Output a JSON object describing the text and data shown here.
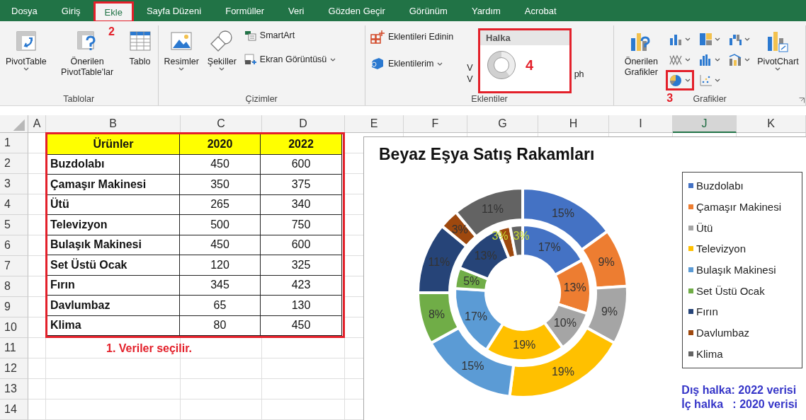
{
  "ribbon_tabs": [
    {
      "label": "Dosya",
      "selected": false
    },
    {
      "label": "Giriş",
      "selected": false
    },
    {
      "label": "Ekle",
      "selected": true,
      "callout": "2"
    },
    {
      "label": "Sayfa Düzeni",
      "selected": false
    },
    {
      "label": "Formüller",
      "selected": false
    },
    {
      "label": "Veri",
      "selected": false
    },
    {
      "label": "Gözden Geçir",
      "selected": false
    },
    {
      "label": "Görünüm",
      "selected": false
    },
    {
      "label": "Yardım",
      "selected": false
    },
    {
      "label": "Acrobat",
      "selected": false
    }
  ],
  "ribbon": {
    "groups": [
      {
        "label": "Tablolar",
        "items": [
          {
            "kind": "large",
            "label": "PivotTable",
            "dropdown": true
          },
          {
            "kind": "large",
            "label": "Önerilen PivotTable'lar",
            "dropdown": false
          },
          {
            "kind": "large",
            "label": "Tablo",
            "dropdown": false
          }
        ]
      },
      {
        "label": "Çizimler",
        "items": [
          {
            "kind": "large",
            "label": "Resimler",
            "dropdown": true
          },
          {
            "kind": "large",
            "label": "Şekiller",
            "dropdown": true
          },
          {
            "kind": "stack",
            "items": [
              {
                "label": "SmartArt",
                "dropdown": false
              },
              {
                "label": "Ekran Görüntüsü",
                "dropdown": true
              }
            ]
          }
        ]
      },
      {
        "label": "Eklentiler",
        "items": [
          {
            "kind": "stack",
            "items": [
              {
                "label": "Eklentileri Edinin",
                "dropdown": false
              },
              {
                "label": "Eklentilerim",
                "dropdown": true
              }
            ]
          },
          {
            "kind": "fragment",
            "lines": [
              "V",
              "V"
            ]
          },
          {
            "kind": "fragment",
            "lines": [
              "ph"
            ]
          }
        ]
      },
      {
        "label": "Grafikler",
        "callout": "3",
        "items": [
          {
            "kind": "large",
            "label": "Önerilen Grafikler",
            "dropdown": false
          },
          {
            "kind": "icon_grid",
            "icons": [
              {
                "dropdown": true,
                "highlighted": false
              },
              {
                "dropdown": true,
                "highlighted": false
              },
              {
                "dropdown": true,
                "highlighted": false
              },
              {
                "dropdown": true,
                "highlighted": false
              },
              {
                "dropdown": true,
                "highlighted": false
              },
              {
                "dropdown": true,
                "highlighted": false
              },
              {
                "dropdown": true,
                "highlighted": true
              },
              {
                "dropdown": true,
                "highlighted": false
              }
            ]
          },
          {
            "kind": "large",
            "label": "PivotChart",
            "dropdown": true
          }
        ]
      }
    ],
    "gallery_popup": {
      "title": "Halka",
      "callout": "4"
    }
  },
  "column_headers": [
    {
      "label": "A",
      "selected": false
    },
    {
      "label": "B",
      "selected": false
    },
    {
      "label": "C",
      "selected": false
    },
    {
      "label": "D",
      "selected": false
    },
    {
      "label": "E",
      "selected": false
    },
    {
      "label": "F",
      "selected": false
    },
    {
      "label": "G",
      "selected": false
    },
    {
      "label": "H",
      "selected": false
    },
    {
      "label": "I",
      "selected": false
    },
    {
      "label": "J",
      "selected": true
    },
    {
      "label": "K",
      "selected": false
    }
  ],
  "row_headers": [
    "1",
    "2",
    "3",
    "4",
    "5",
    "6",
    "7",
    "8",
    "9",
    "10",
    "11",
    "12",
    "13",
    "14"
  ],
  "table": {
    "columns": [
      "Ürünler",
      "2020",
      "2022"
    ],
    "rows": [
      [
        "Buzdolabı",
        "450",
        "600"
      ],
      [
        "Çamaşır Makinesi",
        "350",
        "375"
      ],
      [
        "Ütü",
        "265",
        "340"
      ],
      [
        "Televizyon",
        "500",
        "750"
      ],
      [
        "Bulaşık Makinesi",
        "450",
        "600"
      ],
      [
        "Set Üstü Ocak",
        "120",
        "325"
      ],
      [
        "Fırın",
        "345",
        "423"
      ],
      [
        "Davlumbaz",
        "65",
        "130"
      ],
      [
        "Klima",
        "80",
        "450"
      ]
    ],
    "callout": "1. Veriler seçilir."
  },
  "chart": {
    "chart_data": {
      "type": "donut",
      "title": "Beyaz Eşya Satış Rakamları",
      "categories": [
        "Buzdolabı",
        "Çamaşır Makinesi",
        "Ütü",
        "Televizyon",
        "Bulaşık Makinesi",
        "Set Üstü Ocak",
        "Fırın",
        "Davlumbaz",
        "Klima"
      ],
      "colors": [
        "#4472c4",
        "#ed7d31",
        "#a5a5a5",
        "#ffc000",
        "#5b9bd5",
        "#70ad47",
        "#264478",
        "#9e480e",
        "#636363"
      ],
      "series": [
        {
          "values": [
            17,
            13,
            10,
            19,
            17,
            5,
            13,
            3,
            3
          ]
        },
        {
          "values": [
            15,
            9,
            9,
            19,
            15,
            8,
            11,
            3,
            11
          ]
        }
      ],
      "value_labels": [
        [
          "17%",
          "13%",
          "10%",
          "19%",
          "17%",
          "5%",
          "13%",
          "3%",
          "3%"
        ],
        [
          "15%",
          "9%",
          "9%",
          "19%",
          "15%",
          "8%",
          "11%",
          "3%",
          "11%"
        ]
      ]
    },
    "notes": [
      "Dış halka: 2022 verisi",
      "İç halka   : 2020 verisi"
    ]
  }
}
